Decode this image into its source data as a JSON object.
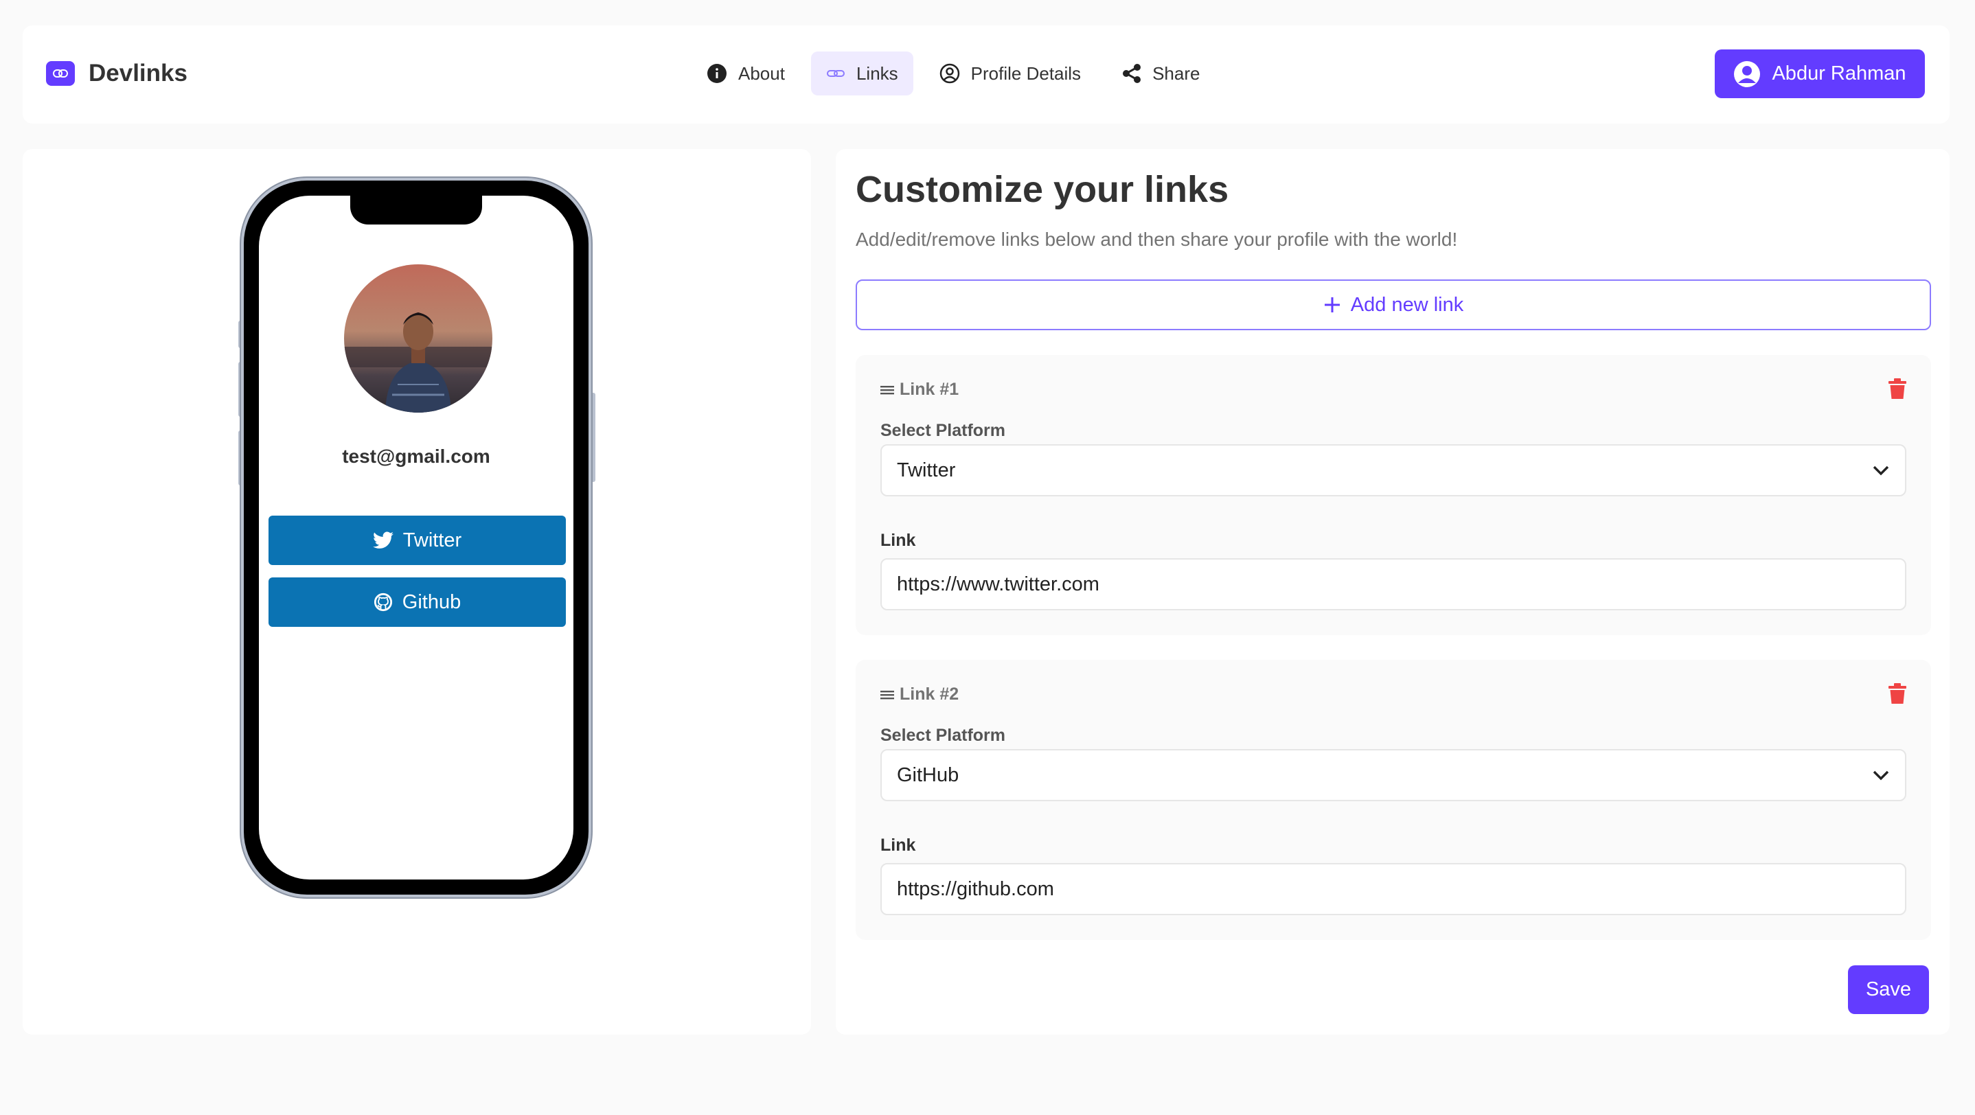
{
  "brand": {
    "name": "Devlinks",
    "accent": "#633cff"
  },
  "nav": [
    {
      "label": "About",
      "icon": "info-icon",
      "active": false
    },
    {
      "label": "Links",
      "icon": "link-icon",
      "active": true
    },
    {
      "label": "Profile Details",
      "icon": "user-circle-icon",
      "active": false
    },
    {
      "label": "Share",
      "icon": "share-icon",
      "active": false
    }
  ],
  "user": {
    "name": "Abdur Rahman",
    "icon": "user-circle-icon"
  },
  "preview": {
    "email": "test@gmail.com",
    "links": [
      {
        "label": "Twitter",
        "icon": "twitter-icon",
        "color": "#0b73b3"
      },
      {
        "label": "Github",
        "icon": "github-icon",
        "color": "#0b73b3"
      }
    ]
  },
  "editor": {
    "title": "Customize your links",
    "subtitle": "Add/edit/remove links below and then share your profile with the world!",
    "add_label": "Add new link",
    "links": [
      {
        "heading": "Link #1",
        "platform_label": "Select Platform",
        "platform": "Twitter",
        "link_label": "Link",
        "url": "https://www.twitter.com"
      },
      {
        "heading": "Link #2",
        "platform_label": "Select Platform",
        "platform": "GitHub",
        "link_label": "Link",
        "url": "https://github.com"
      }
    ],
    "save_label": "Save",
    "delete_color": "#ef4444"
  }
}
